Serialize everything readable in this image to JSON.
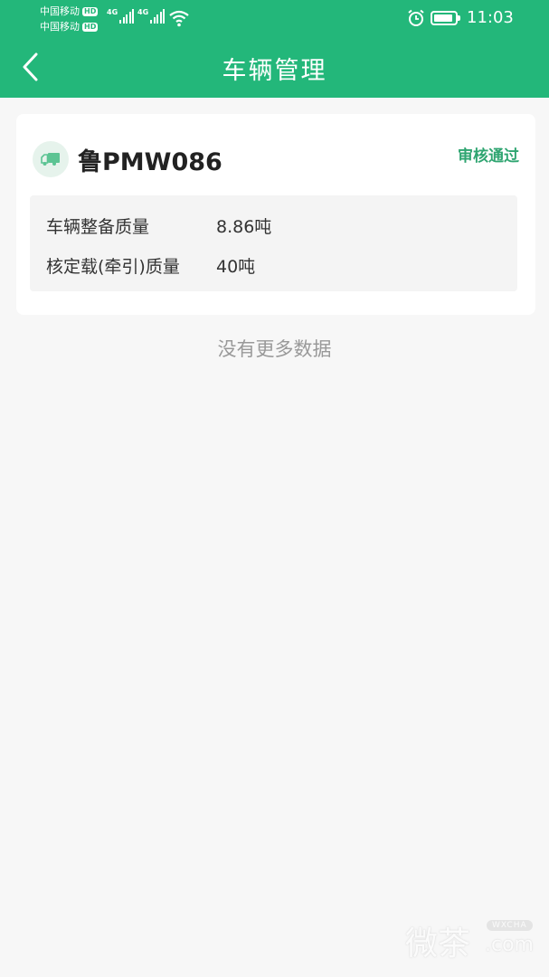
{
  "status_bar": {
    "carrier1": "中国移动",
    "carrier2": "中国移动",
    "hd_label": "HD",
    "network_tag": "4G",
    "battery_level": 0.9,
    "time": "11:03"
  },
  "header": {
    "title": "车辆管理",
    "back_icon": "chevron-left-icon",
    "background_color": "#23b77a"
  },
  "vehicle": {
    "icon": "truck-icon",
    "plate": "鲁PMW086",
    "status": "审核通过",
    "status_color": "#2fa571",
    "details": [
      {
        "label": "车辆整备质量",
        "value": "8.86吨"
      },
      {
        "label": "核定载(牵引)质量",
        "value": "40吨"
      }
    ]
  },
  "footer_text": "没有更多数据",
  "watermark": {
    "text": "微茶",
    "badge": "WXCHA",
    "domain": ".com"
  }
}
